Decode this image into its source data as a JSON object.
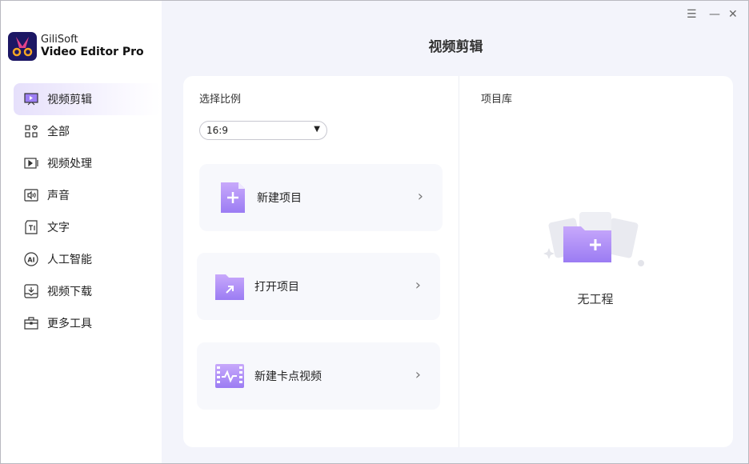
{
  "app": {
    "brand_line1": "GiliSoft",
    "brand_line2": "Video Editor Pro"
  },
  "window": {
    "menu_icon": "menu-icon",
    "minimize_icon": "minimize-icon",
    "close_icon": "close-icon"
  },
  "sidebar": {
    "items": [
      {
        "label": "视频剪辑",
        "icon": "video-edit-icon",
        "active": true
      },
      {
        "label": "全部",
        "icon": "grid-icon"
      },
      {
        "label": "视频处理",
        "icon": "video-process-icon"
      },
      {
        "label": "声音",
        "icon": "audio-icon"
      },
      {
        "label": "文字",
        "icon": "text-icon"
      },
      {
        "label": "人工智能",
        "icon": "ai-icon"
      },
      {
        "label": "视频下载",
        "icon": "download-icon"
      },
      {
        "label": "更多工具",
        "icon": "toolbox-icon"
      }
    ]
  },
  "main": {
    "title": "视频剪辑",
    "ratio_label": "选择比例",
    "ratio_value": "16:9",
    "options": [
      {
        "label": "新建项目"
      },
      {
        "label": "打开项目"
      },
      {
        "label": "新建卡点视频"
      }
    ],
    "library_label": "项目库",
    "empty_text": "无工程"
  },
  "colors": {
    "accent": "#9d7ff5",
    "sidebar_active": "#e6e0fb"
  }
}
